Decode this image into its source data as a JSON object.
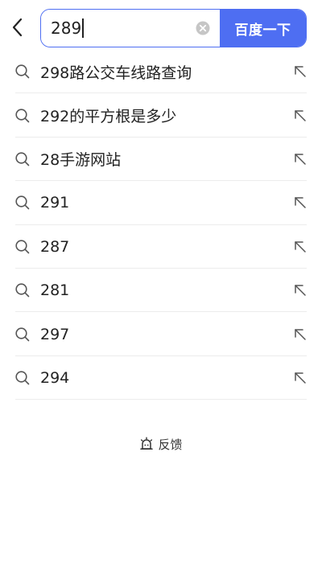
{
  "header": {
    "back_icon": "chevron-left-icon",
    "search": {
      "value": "289",
      "clear_icon": "clear-circle-icon"
    },
    "submit_label": "百度一下",
    "accent_color": "#4e6ef2"
  },
  "suggestions": [
    {
      "text": "298路公交车线路查询"
    },
    {
      "text": "292的平方根是多少"
    },
    {
      "text": "28手游网站"
    },
    {
      "text": "291"
    },
    {
      "text": "287"
    },
    {
      "text": "281"
    },
    {
      "text": "297"
    },
    {
      "text": "294"
    }
  ],
  "suggestion_icons": {
    "leading": "search-icon",
    "trailing": "arrow-up-left-icon"
  },
  "feedback": {
    "label": "反馈",
    "icon": "feedback-icon"
  }
}
